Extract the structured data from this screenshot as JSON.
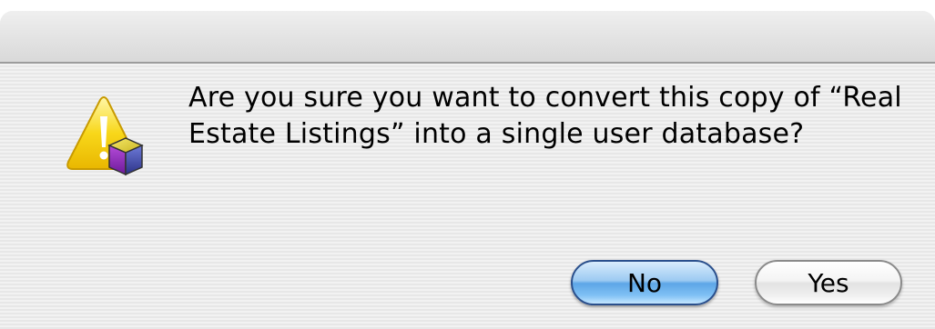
{
  "dialog": {
    "message": "Are you sure you want to convert this copy of “Real Estate Listings” into a single user database?",
    "icon": "caution-icon"
  },
  "buttons": {
    "no_label": "No",
    "yes_label": "Yes"
  },
  "colors": {
    "default_button": "#7fc0f4",
    "window_background": "#ececec"
  }
}
